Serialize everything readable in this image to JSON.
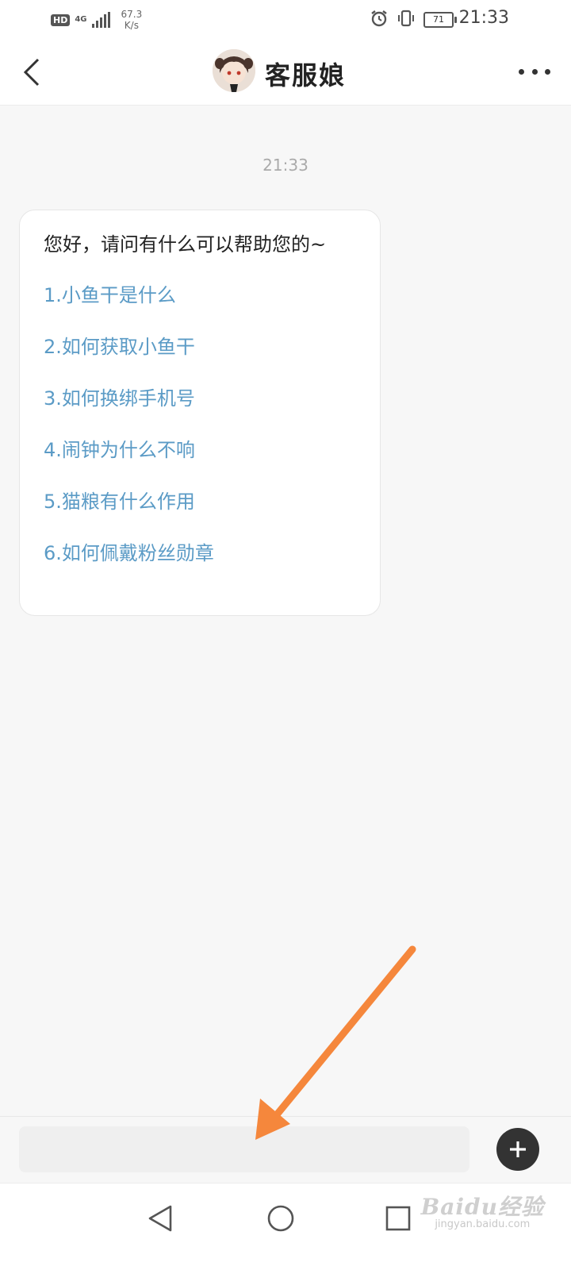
{
  "status_bar": {
    "hd": "HD",
    "network": "4G",
    "speed_value": "67.3",
    "speed_unit": "K/s",
    "battery": "71",
    "time": "21:33"
  },
  "header": {
    "title": "客服娘"
  },
  "chat": {
    "timestamp": "21:33",
    "message": {
      "greeting": "您好，请问有什么可以帮助您的~",
      "options": [
        "1.小鱼干是什么",
        "2.如何获取小鱼干",
        "3.如何换绑手机号",
        "4.闹钟为什么不响",
        "5.猫粮有什么作用",
        "6.如何佩戴粉丝勋章"
      ]
    }
  },
  "input": {
    "value": "",
    "placeholder": ""
  },
  "watermark": {
    "main": "Baidu经验",
    "sub": "jingyan.baidu.com"
  },
  "colors": {
    "link": "#5b9bc6",
    "annotation_arrow": "#f5873c",
    "plus_button": "#333333"
  }
}
